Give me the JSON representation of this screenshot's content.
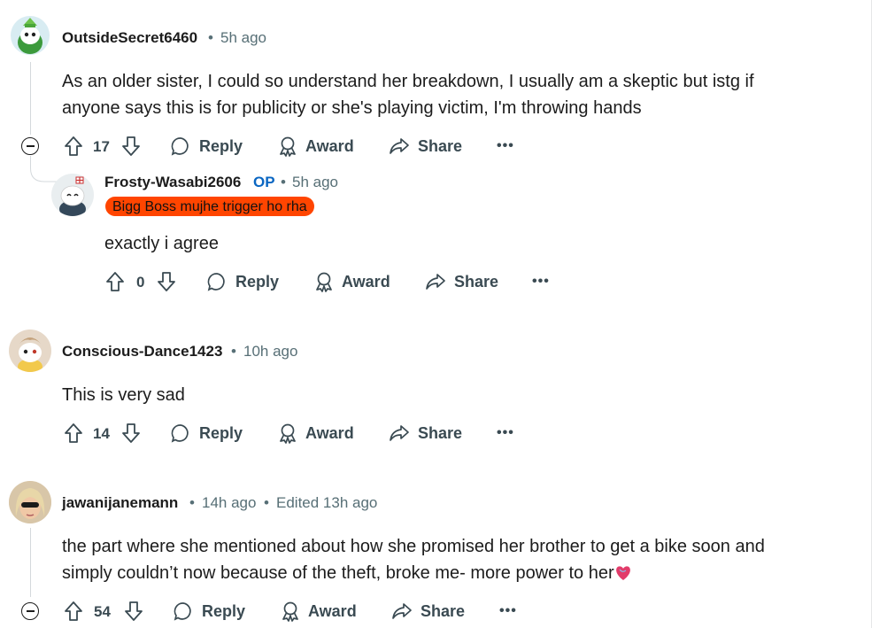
{
  "comments": [
    {
      "username": "OutsideSecret6460",
      "time": "5h ago",
      "text_line1": "As an older sister, I could so understand her breakdown, I usually am a skeptic but istg if",
      "text_line2": "anyone says this is for publicity or she's playing victim, I'm throwing hands",
      "votes": "17",
      "reply_label": "Reply",
      "award_label": "Award",
      "share_label": "Share",
      "more": "•••"
    },
    {
      "username": "Frosty-Wasabi2606",
      "op_badge": "OP",
      "time": "5h ago",
      "flair": "Bigg Boss mujhe trigger ho rha",
      "text_line1": "exactly i agree",
      "votes": "0",
      "reply_label": "Reply",
      "award_label": "Award",
      "share_label": "Share",
      "more": "•••"
    },
    {
      "username": "Conscious-Dance1423",
      "time": "10h ago",
      "text_line1": "This is very sad",
      "votes": "14",
      "reply_label": "Reply",
      "award_label": "Award",
      "share_label": "Share",
      "more": "•••"
    },
    {
      "username": "jawanijanemann",
      "time": "14h ago",
      "edited": "Edited 13h ago",
      "text_line1": "the part where she mentioned about how she promised her brother to get a bike soon and",
      "text_line2": "simply couldn’t now because of the theft, broke me- more power to her",
      "votes": "54",
      "reply_label": "Reply",
      "award_label": "Award",
      "share_label": "Share",
      "more": "•••"
    }
  ],
  "separator": "•",
  "colors": {
    "flair_bg": "#ff4500",
    "op_blue": "#0a66c2",
    "meta_gray": "#576f76"
  }
}
